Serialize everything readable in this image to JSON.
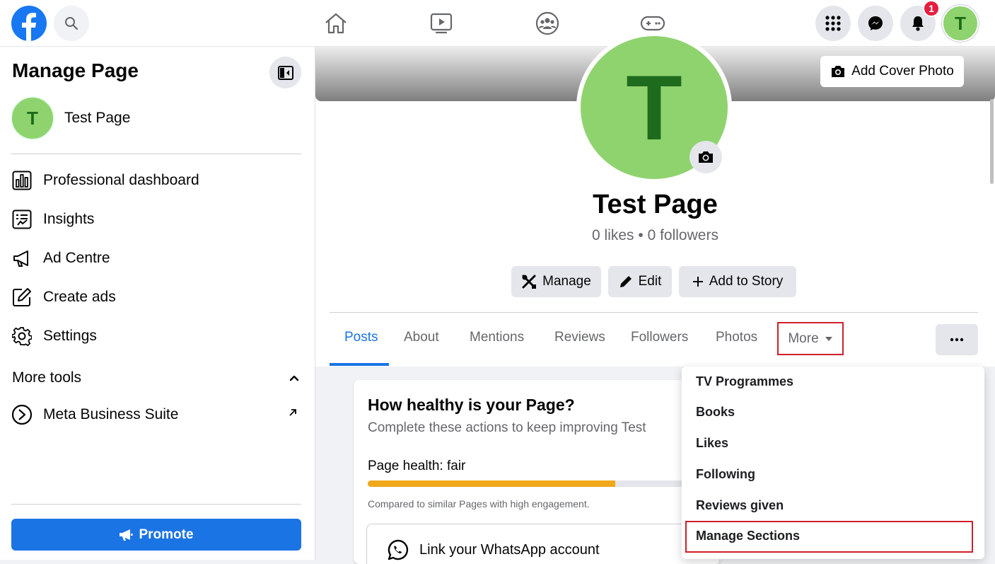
{
  "topbar": {
    "notification_count": "1",
    "user_initial": "T",
    "colors": {
      "brand": "#1877f2",
      "badge": "#e41e3f"
    }
  },
  "sidebar": {
    "title": "Manage Page",
    "page_name": "Test Page",
    "page_initial": "T",
    "items": [
      {
        "label": "Professional dashboard",
        "icon": "bar-chart-icon"
      },
      {
        "label": "Insights",
        "icon": "insights-icon"
      },
      {
        "label": "Ad Centre",
        "icon": "megaphone-icon"
      },
      {
        "label": "Create ads",
        "icon": "pencil-square-icon"
      },
      {
        "label": "Settings",
        "icon": "gear-icon"
      }
    ],
    "more_tools_label": "More tools",
    "tools": [
      {
        "label": "Meta Business Suite",
        "icon": "meta-business-suite-icon"
      }
    ],
    "promote_label": "Promote"
  },
  "profile": {
    "cover_button_label": "Add Cover Photo",
    "initial": "T",
    "name": "Test Page",
    "stats": "0 likes • 0 followers",
    "actions": {
      "manage": "Manage",
      "edit": "Edit",
      "add_to_story": "Add to Story"
    }
  },
  "tabs": {
    "items": [
      "Posts",
      "About",
      "Mentions",
      "Reviews",
      "Followers",
      "Photos"
    ],
    "active": "Posts",
    "more_label": "More"
  },
  "health_card": {
    "title": "How healthy is your Page?",
    "subtitle": "Complete these actions to keep improving Test",
    "health_label": "Page health: fair",
    "health_fraction": 0.73,
    "note": "Compared to similar Pages with high engagement.",
    "whatsapp_label": "Link your WhatsApp account"
  },
  "more_menu": {
    "items": [
      "TV Programmes",
      "Books",
      "Likes",
      "Following",
      "Reviews given",
      "Manage Sections"
    ],
    "highlighted": "Manage Sections"
  }
}
